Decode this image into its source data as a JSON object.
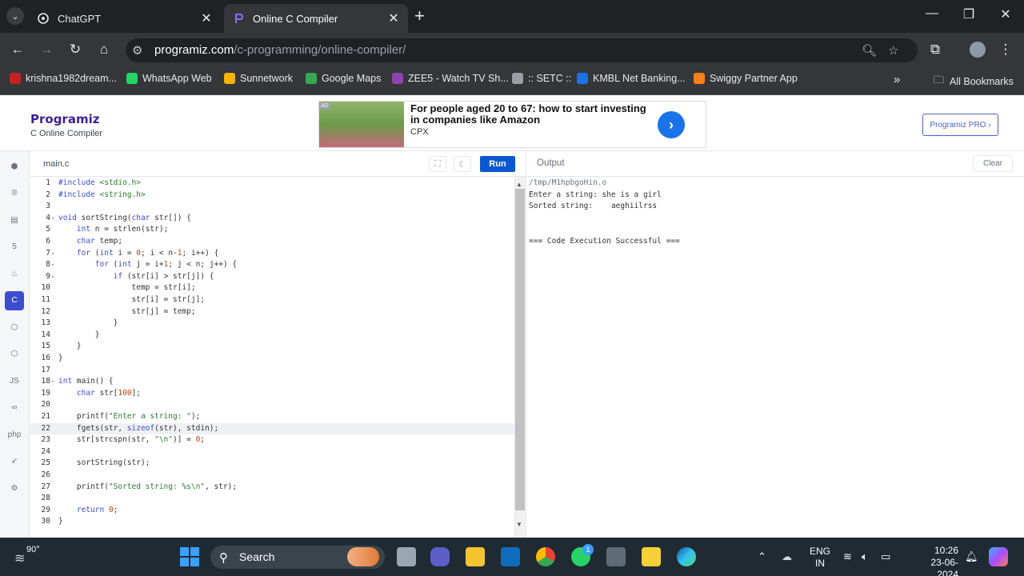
{
  "browser": {
    "tabs": [
      {
        "label": "ChatGPT",
        "icon": "chatgpt-icon",
        "active": false
      },
      {
        "label": "Online C Compiler",
        "icon": "programiz-icon",
        "active": true
      }
    ],
    "url_host": "programiz.com",
    "url_path": "/c-programming/online-compiler/",
    "bookmarks": [
      {
        "label": "krishna1982dream...",
        "color": "#c5221f"
      },
      {
        "label": "WhatsApp Web",
        "color": "#25d366"
      },
      {
        "label": "Sunnetwork",
        "color": "#f4b400"
      },
      {
        "label": "Google Maps",
        "color": "#34a853"
      },
      {
        "label": "ZEE5 - Watch TV Sh...",
        "color": "#8e44ad"
      },
      {
        "label": ":: SETC ::",
        "color": "#9aa0a6"
      },
      {
        "label": "KMBL Net Banking...",
        "color": "#1a73e8"
      },
      {
        "label": "Swiggy Partner App",
        "color": "#fc8019"
      }
    ],
    "all_bookmarks": "All Bookmarks",
    "overflow": "»"
  },
  "site": {
    "logo": "Programiz",
    "subtitle": "C Online Compiler",
    "ad": {
      "badge": "AD",
      "headline": "For people aged 20 to 67: how to start investing in companies like Amazon",
      "source": "CPX",
      "arrow": "›"
    },
    "pro_button": "Programiz PRO ›"
  },
  "languages": [
    {
      "name": "python-icon",
      "glyph": "⬢",
      "active": false
    },
    {
      "name": "r-icon",
      "glyph": "®",
      "active": false
    },
    {
      "name": "sql-icon",
      "glyph": "▤",
      "active": false
    },
    {
      "name": "html-icon",
      "glyph": "5",
      "active": false
    },
    {
      "name": "java-icon",
      "glyph": "♨",
      "active": false
    },
    {
      "name": "c-icon",
      "glyph": "C",
      "active": true
    },
    {
      "name": "cpp-icon",
      "glyph": "⬡",
      "active": false
    },
    {
      "name": "csharp-icon",
      "glyph": "⬡",
      "active": false
    },
    {
      "name": "js-icon",
      "glyph": "JS",
      "active": false
    },
    {
      "name": "go-icon",
      "glyph": "∞",
      "active": false
    },
    {
      "name": "php-icon",
      "glyph": "php",
      "active": false
    },
    {
      "name": "swift-icon",
      "glyph": "➶",
      "active": false
    },
    {
      "name": "rust-icon",
      "glyph": "⚙",
      "active": false
    }
  ],
  "editor": {
    "file_tab": "main.c",
    "run_label": "Run",
    "highlight_line": 22,
    "lines": [
      "#include <stdio.h>",
      "#include <string.h>",
      "",
      "void sortString(char str[]) {",
      "    int n = strlen(str);",
      "    char temp;",
      "    for (int i = 0; i < n-1; i++) {",
      "        for (int j = i+1; j < n; j++) {",
      "            if (str[i] > str[j]) {",
      "                temp = str[i];",
      "                str[i] = str[j];",
      "                str[j] = temp;",
      "            }",
      "        }",
      "    }",
      "}",
      "",
      "int main() {",
      "    char str[100];",
      "",
      "    printf(\"Enter a string: \");",
      "    fgets(str, sizeof(str), stdin);",
      "    str[strcspn(str, \"\\n\")] = 0;",
      "",
      "    sortString(str);",
      "",
      "    printf(\"Sorted string: %s\\n\", str);",
      "",
      "    return 0;",
      "}"
    ],
    "fold_lines": [
      4,
      7,
      8,
      9,
      18
    ]
  },
  "output": {
    "title": "Output",
    "clear_label": "Clear",
    "lines": [
      "/tmp/M1hpbgoHin.o",
      "Enter a string: she is a girl",
      "Sorted string:    aeghiilrss",
      "",
      "",
      "=== Code Execution Successful ==="
    ]
  },
  "taskbar": {
    "temperature": "90°",
    "search_placeholder": "Search",
    "whatsapp_badge": "1",
    "language_line1": "ENG",
    "language_line2": "IN",
    "time": "10:26",
    "date": "23-06-2024"
  }
}
